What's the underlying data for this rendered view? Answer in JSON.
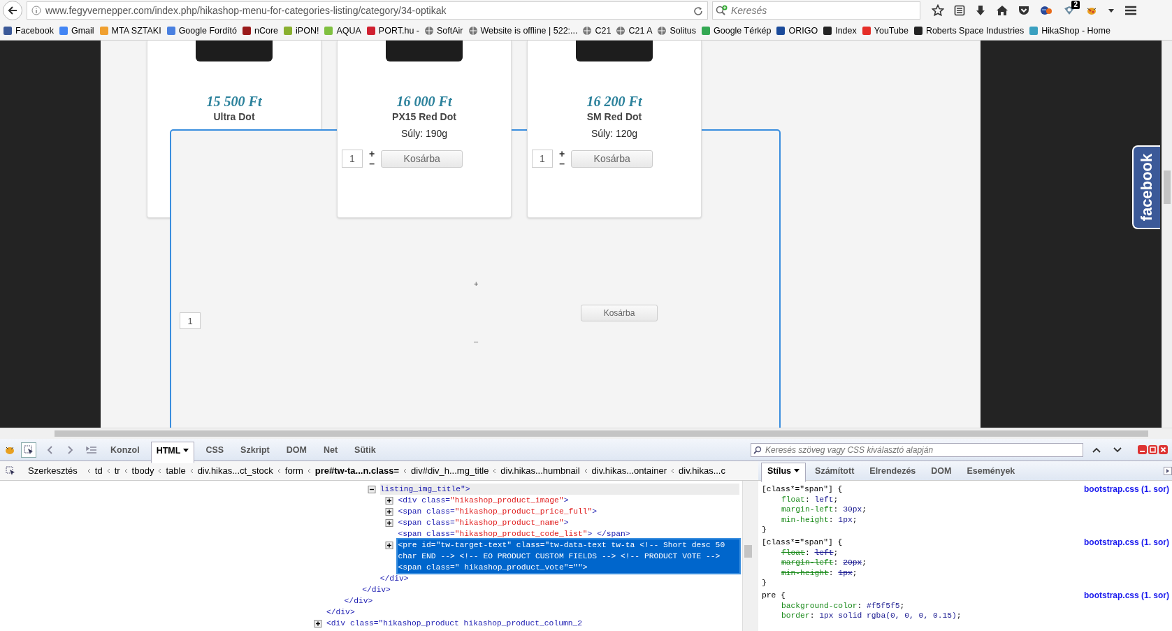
{
  "browser": {
    "url": "www.fegyvernepper.com/index.php/hikashop-menu-for-categories-listing/category/34-optikak",
    "search_placeholder": "Keresés",
    "badge": "2"
  },
  "bookmarks": [
    {
      "label": "Facebook"
    },
    {
      "label": "Gmail"
    },
    {
      "label": "MTA SZTAKI"
    },
    {
      "label": "Google Fordító"
    },
    {
      "label": "nCore"
    },
    {
      "label": "iPON!"
    },
    {
      "label": "AQUA"
    },
    {
      "label": "PORT.hu -"
    },
    {
      "label": "SoftAir"
    },
    {
      "label": "Website is offline | 522:..."
    },
    {
      "label": "C21"
    },
    {
      "label": "C21 A"
    },
    {
      "label": "Solitus"
    },
    {
      "label": "Google Térkép"
    },
    {
      "label": "ORIGO"
    },
    {
      "label": "Index"
    },
    {
      "label": "YouTube"
    },
    {
      "label": "Roberts Space Industries"
    },
    {
      "label": "HikaShop - Home"
    }
  ],
  "products": [
    {
      "price": "15 500 Ft",
      "name": "Ultra Dot"
    },
    {
      "price": "16 000 Ft",
      "name": "PX15 Red Dot",
      "weight": "Súly: 190g",
      "quantity": "1",
      "plus": "+",
      "minus": "–",
      "button": "Kosárba"
    },
    {
      "price": "16 200 Ft",
      "name": "SM Red Dot",
      "weight": "Súly: 120g",
      "quantity": "1",
      "plus": "+",
      "minus": "–",
      "button": "Kosárba"
    }
  ],
  "overlay": {
    "quantity": "1",
    "plus": "+",
    "minus": "–",
    "button": "Kosárba"
  },
  "facebook_tab": {
    "label": "facebook"
  },
  "devtools": {
    "tabs": [
      {
        "label": "Konzol",
        "selected": false
      },
      {
        "label": "HTML",
        "selected": true
      },
      {
        "label": "CSS",
        "selected": false
      },
      {
        "label": "Szkript",
        "selected": false
      },
      {
        "label": "DOM",
        "selected": false
      },
      {
        "label": "Net",
        "selected": false
      },
      {
        "label": "Sütik",
        "selected": false
      }
    ],
    "search_placeholder": "Keresés szöveg vagy CSS kiválasztó alapján",
    "edit_button": "Szerkesztés",
    "breadcrumbs": [
      {
        "label": "td",
        "selected": false
      },
      {
        "label": "tr",
        "selected": false
      },
      {
        "label": "tbody",
        "selected": false
      },
      {
        "label": "table",
        "selected": false
      },
      {
        "label": "div.hikas...ct_stock",
        "selected": false
      },
      {
        "label": "form",
        "selected": false
      },
      {
        "label": "pre#tw-ta...n.class=",
        "selected": true
      },
      {
        "label": "div#div_h...mg_title",
        "selected": false
      },
      {
        "label": "div.hikas...humbnail",
        "selected": false
      },
      {
        "label": "div.hikas...ontainer",
        "selected": false
      },
      {
        "label": "div.hikas...c",
        "selected": false
      }
    ],
    "side_tabs": [
      {
        "label": "Stílus",
        "selected": true
      },
      {
        "label": "Számított",
        "selected": false
      },
      {
        "label": "Elrendezés",
        "selected": false
      },
      {
        "label": "DOM",
        "selected": false
      },
      {
        "label": "Események",
        "selected": false
      }
    ],
    "html_tree": [
      {
        "close": "</div>",
        "children": [
          {
            "close": "</div>",
            "children": [
              {
                "close": "</div>",
                "children": [
                  {
                    "kind": "collapsible",
                    "expanded": true,
                    "selected": false,
                    "open": "listing_img_title\">",
                    "close": "</div>",
                    "children": [
                      {
                        "kind": "collapsible",
                        "expanded": false,
                        "selected": false,
                        "open": "<div class=\"hikashop_product_image\">"
                      },
                      {
                        "kind": "collapsible",
                        "expanded": false,
                        "selected": false,
                        "open": "<span class=\"hikashop_product_price_full\">"
                      },
                      {
                        "kind": "collapsible",
                        "expanded": false,
                        "selected": false,
                        "open": "<span class=\"hikashop_product_name\">"
                      },
                      {
                        "kind": "leaf",
                        "selected": false,
                        "open": "<span class=\"hikashop_product_code_list\"> </span>"
                      },
                      {
                        "kind": "collapsible",
                        "expanded": false,
                        "selected": true,
                        "open": "<pre id=\"tw-target-text\" class=\"tw-data-text tw-ta <!-- Short desc 50 char END --> <!-- EO PRODUCT CUSTOM FIELDS --> <!-- PRODUCT VOTE --> <span class=\" hikashop_product_vote\"=\"\">"
                      }
                    ]
                  }
                ]
              }
            ]
          }
        ]
      },
      {
        "kind": "collapsible",
        "expanded": false,
        "selected": false,
        "open": "<div class=\"hikashop_product hikashop_product_column_2"
      }
    ],
    "css_rules": [
      {
        "selector": "[class*=\"span\"] {",
        "source": "bootstrap.css (1. sor)",
        "close": "}",
        "properties": [
          {
            "text": "float: left;",
            "overridden": false
          },
          {
            "text": "margin-left: 30px;",
            "overridden": false
          },
          {
            "text": "min-height: 1px;",
            "overridden": false
          }
        ]
      },
      {
        "selector": "[class*=\"span\"] {",
        "source": "bootstrap.css (1. sor)",
        "close": "}",
        "properties": [
          {
            "text": "float: left;",
            "overridden": true
          },
          {
            "text": "margin-left: 20px;",
            "overridden": true
          },
          {
            "text": "min-height: 1px;",
            "overridden": true
          }
        ]
      },
      {
        "selector": "pre {",
        "source": "bootstrap.css (1. sor)",
        "properties": [
          {
            "text": "background-color: #f5f5f5;",
            "overridden": false
          },
          {
            "text": "border: 1px solid rgba(0, 0, 0, 0.15);",
            "overridden": false
          }
        ]
      }
    ]
  }
}
